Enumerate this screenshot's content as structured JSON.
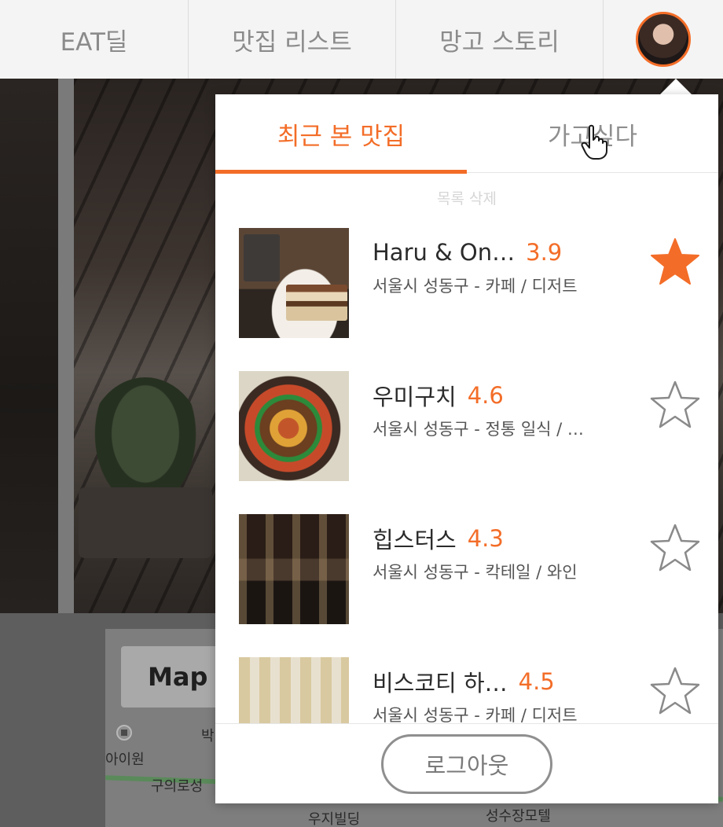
{
  "nav": {
    "items": [
      {
        "label": "EAT딜"
      },
      {
        "label": "맛집 리스트"
      },
      {
        "label": "망고 스토리"
      }
    ]
  },
  "map": {
    "title": "Map",
    "labels": [
      "아이원",
      "구의로성",
      "우지빌딩",
      "성수장모텔",
      "박"
    ]
  },
  "dropdown": {
    "tabs": [
      {
        "label": "최근 본 맛집",
        "active": true
      },
      {
        "label": "가고싶다",
        "active": false
      }
    ],
    "clear_label": "목록 삭제",
    "restaurants": [
      {
        "name": "Haru & On…",
        "rating": "3.9",
        "subtitle": "서울시 성동구 - 카페 / 디저트",
        "starred": true
      },
      {
        "name": "우미구치",
        "rating": "4.6",
        "subtitle": "서울시 성동구 - 정통 일식 / …",
        "starred": false
      },
      {
        "name": "힙스터스",
        "rating": "4.3",
        "subtitle": "서울시 성동구 - 칵테일 / 와인",
        "starred": false
      },
      {
        "name": "비스코티 하…",
        "rating": "4.5",
        "subtitle": "서울시 성동구 - 카페 / 디저트",
        "starred": false
      }
    ],
    "logout_label": "로그아웃"
  },
  "colors": {
    "accent": "#f36d28",
    "text_primary": "#2b2b2b",
    "text_muted": "#8e8e8e"
  }
}
